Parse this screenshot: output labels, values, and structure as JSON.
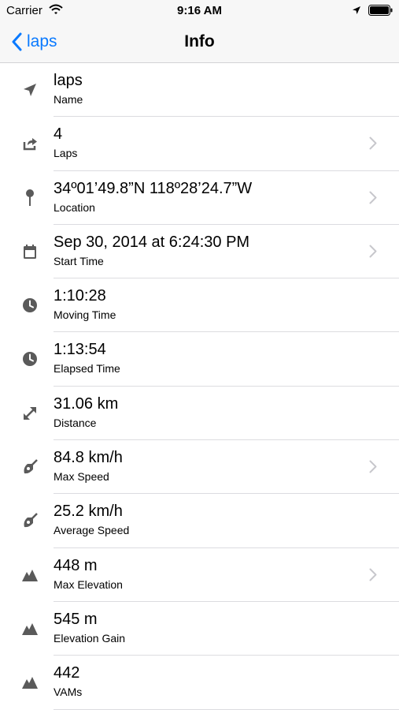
{
  "status_bar": {
    "carrier": "Carrier",
    "time": "9:16 AM"
  },
  "nav": {
    "back_label": "laps",
    "title": "Info"
  },
  "colors": {
    "accent": "#0a7aff",
    "icon": "#5a5a5a",
    "chevron": "#c7c7cc"
  },
  "rows": [
    {
      "value": "laps",
      "label": "Name",
      "icon": "location-arrow-icon",
      "chevron": false
    },
    {
      "value": "4",
      "label": "Laps",
      "icon": "repeat-share-icon",
      "chevron": true
    },
    {
      "value": "34º01’49.8”N 118º28’24.7”W",
      "label": "Location",
      "icon": "pin-icon",
      "chevron": true
    },
    {
      "value": "Sep 30, 2014 at 6:24:30 PM",
      "label": "Start Time",
      "icon": "calendar-icon",
      "chevron": true
    },
    {
      "value": "1:10:28",
      "label": "Moving Time",
      "icon": "clock-icon",
      "chevron": false
    },
    {
      "value": "1:13:54",
      "label": "Elapsed Time",
      "icon": "clock-icon",
      "chevron": false
    },
    {
      "value": "31.06 km",
      "label": "Distance",
      "icon": "distance-arrows-icon",
      "chevron": false
    },
    {
      "value": "84.8 km/h",
      "label": "Max Speed",
      "icon": "speed-icon",
      "chevron": true
    },
    {
      "value": "25.2 km/h",
      "label": "Average Speed",
      "icon": "speed-icon",
      "chevron": false
    },
    {
      "value": "448 m",
      "label": "Max Elevation",
      "icon": "mountain-icon",
      "chevron": true
    },
    {
      "value": "545 m",
      "label": "Elevation Gain",
      "icon": "mountain-icon",
      "chevron": false
    },
    {
      "value": "442",
      "label": "VAMs",
      "icon": "mountain-icon",
      "chevron": false
    }
  ]
}
